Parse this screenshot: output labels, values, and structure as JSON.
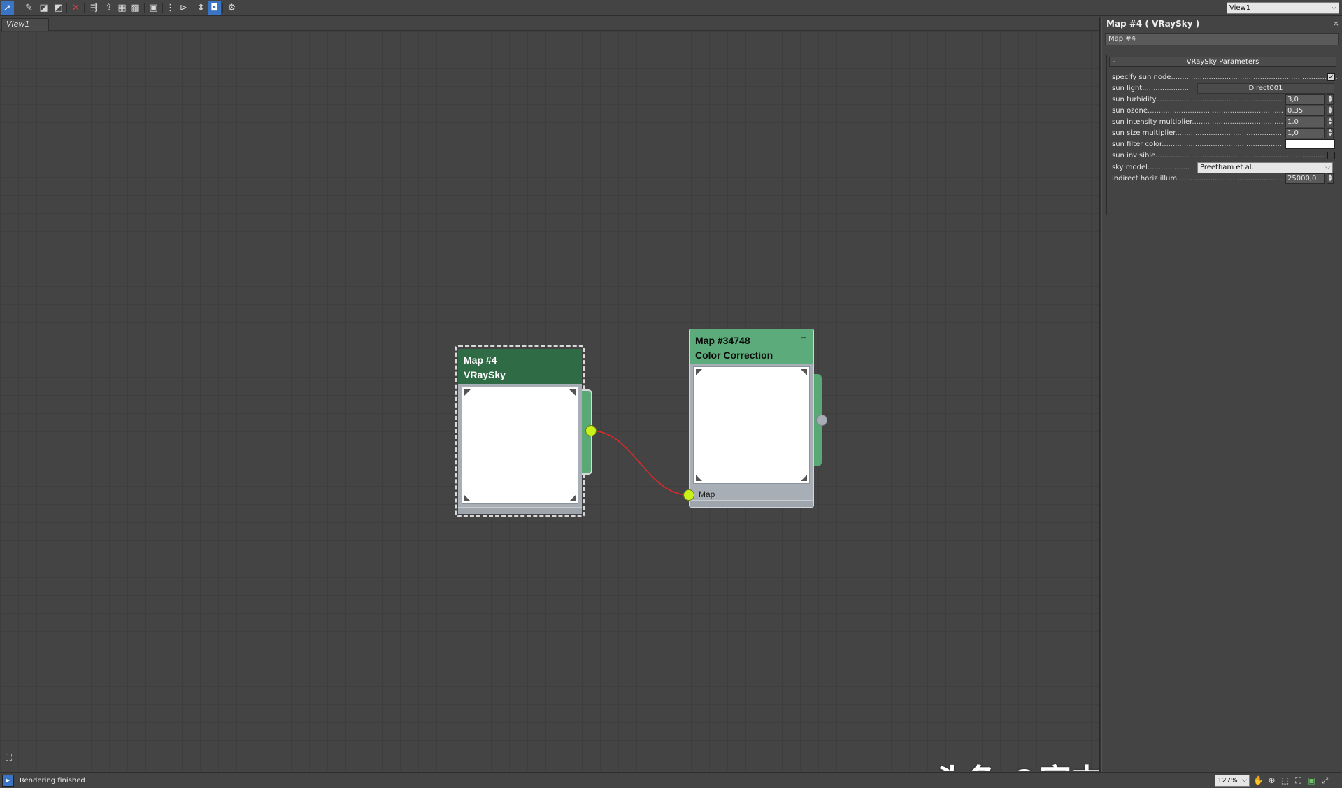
{
  "toolbar": {
    "icons": [
      "select-arrow-icon",
      "eyedropper-icon",
      "assign-material-icon",
      "put-to-library-icon",
      "delete-icon",
      "move-children-icon",
      "layout-all-icon",
      "show-map-icon",
      "show-background-icon",
      "checker-icon",
      "preview-sphere-icon",
      "layout-vertical-icon",
      "layout-horizontal-icon",
      "hide-unused-icon",
      "select-node-mode-icon",
      "options-icon"
    ],
    "view_select": "View1"
  },
  "view_tab": {
    "label": "View1"
  },
  "nodes": {
    "vraysky": {
      "name": "Map #4",
      "type": "VRaySky",
      "color": "#2f6b45"
    },
    "color_correction": {
      "name": "Map #34748",
      "type": "Color Correction",
      "input_label": "Map",
      "color": "#5cac7b",
      "minimize": "−"
    }
  },
  "wire_color": "#e0282a",
  "socket_color": "#c9f21a",
  "right_panel": {
    "title": "Map #4  ( VRaySky )",
    "name_field": "Map #4",
    "rollout": {
      "collapse": "-",
      "title": "VRaySky Parameters"
    },
    "params": [
      {
        "label": "specify sun node",
        "control": "checkbox",
        "value": "✓"
      },
      {
        "label": "sun light",
        "control": "button",
        "value": "Direct001"
      },
      {
        "label": "sun turbidity",
        "control": "spinner",
        "value": "3,0"
      },
      {
        "label": "sun ozone",
        "control": "spinner",
        "value": "0,35"
      },
      {
        "label": "sun intensity multiplier",
        "control": "spinner",
        "value": "1,0"
      },
      {
        "label": "sun size multiplier",
        "control": "spinner",
        "value": "1,0"
      },
      {
        "label": "sun filter color",
        "control": "color",
        "value": "#ffffff"
      },
      {
        "label": "sun invisible",
        "control": "checkbox",
        "value": ""
      },
      {
        "label": "sky model",
        "control": "dropdown",
        "value": "Preetham et al."
      },
      {
        "label": "indirect horiz illum",
        "control": "spinner",
        "value": "25000,0"
      }
    ]
  },
  "status": {
    "text": "Rendering finished",
    "zoom": "127%"
  },
  "watermark": "头条 @室内设计谈单技巧"
}
